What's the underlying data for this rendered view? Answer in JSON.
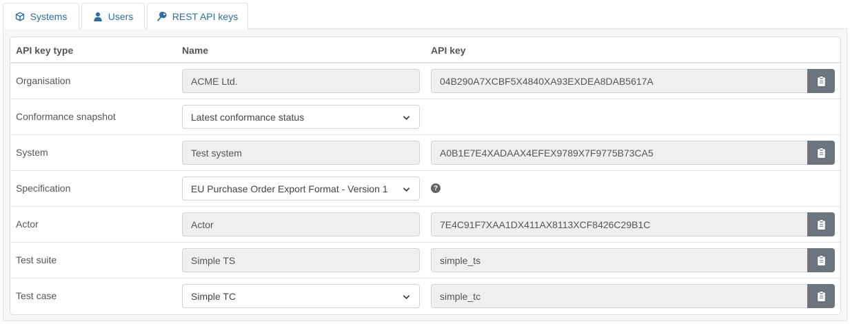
{
  "tabs": [
    {
      "label": "Systems",
      "icon": "cube-icon"
    },
    {
      "label": "Users",
      "icon": "user-icon"
    },
    {
      "label": "REST API keys",
      "icon": "key-icon",
      "active": true
    }
  ],
  "table": {
    "headers": {
      "type": "API key type",
      "name": "Name",
      "key": "API key"
    },
    "rows": [
      {
        "type": "Organisation",
        "name": "ACME Ltd.",
        "name_kind": "readonly",
        "key": "04B290A7XCBF5X4840XA93EXDEA8DAB5617A"
      },
      {
        "type": "Conformance snapshot",
        "name": "Latest conformance status",
        "name_kind": "select",
        "key": null
      },
      {
        "type": "System",
        "name": "Test system",
        "name_kind": "readonly",
        "key": "A0B1E7E4XADAAX4EFEX9789X7F9775B73CA5"
      },
      {
        "type": "Specification",
        "name": "EU Purchase Order Export Format - Version 1",
        "name_kind": "select",
        "key": null,
        "help": "?"
      },
      {
        "type": "Actor",
        "name": "Actor",
        "name_kind": "readonly",
        "key": "7E4C91F7XAA1DX411AX8113XCF8426C29B1C"
      },
      {
        "type": "Test suite",
        "name": "Simple TS",
        "name_kind": "readonly",
        "key": "simple_ts"
      },
      {
        "type": "Test case",
        "name": "Simple TC",
        "name_kind": "select",
        "key": "simple_tc"
      }
    ]
  },
  "colors": {
    "link": "#2c6ca3",
    "button": "#6c757d",
    "readonly_bg": "#efefef"
  }
}
